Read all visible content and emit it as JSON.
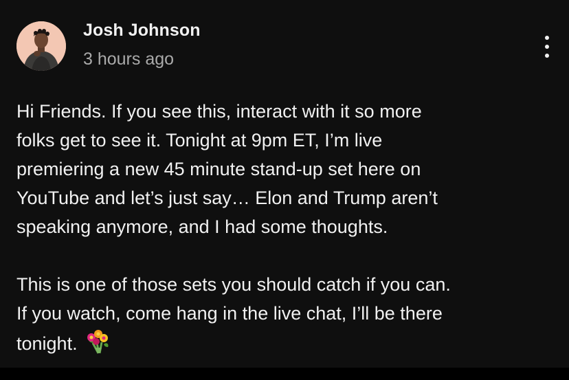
{
  "post": {
    "author": "Josh Johnson",
    "time_ago": "3 hours ago",
    "paragraphs": [
      "Hi Friends. If you see this, interact with it so more\nfolks get to see it. Tonight at 9pm ET, I’m live\npremiering a new 45 minute stand-up set here on\nYouTube and let’s just say… Elon and Trump aren’t\nspeaking anymore, and I had some thoughts.",
      "This is one of those sets you should catch if you can.\nIf you watch, come hang in the live chat, I’ll be there\ntonight."
    ],
    "emoji": "bouquet-emoji"
  },
  "colors": {
    "background": "#0f0f0f",
    "primary_text": "#f1f1f1",
    "secondary_text": "#aaaaaa"
  },
  "icons": {
    "menu": "more-vert-icon"
  }
}
